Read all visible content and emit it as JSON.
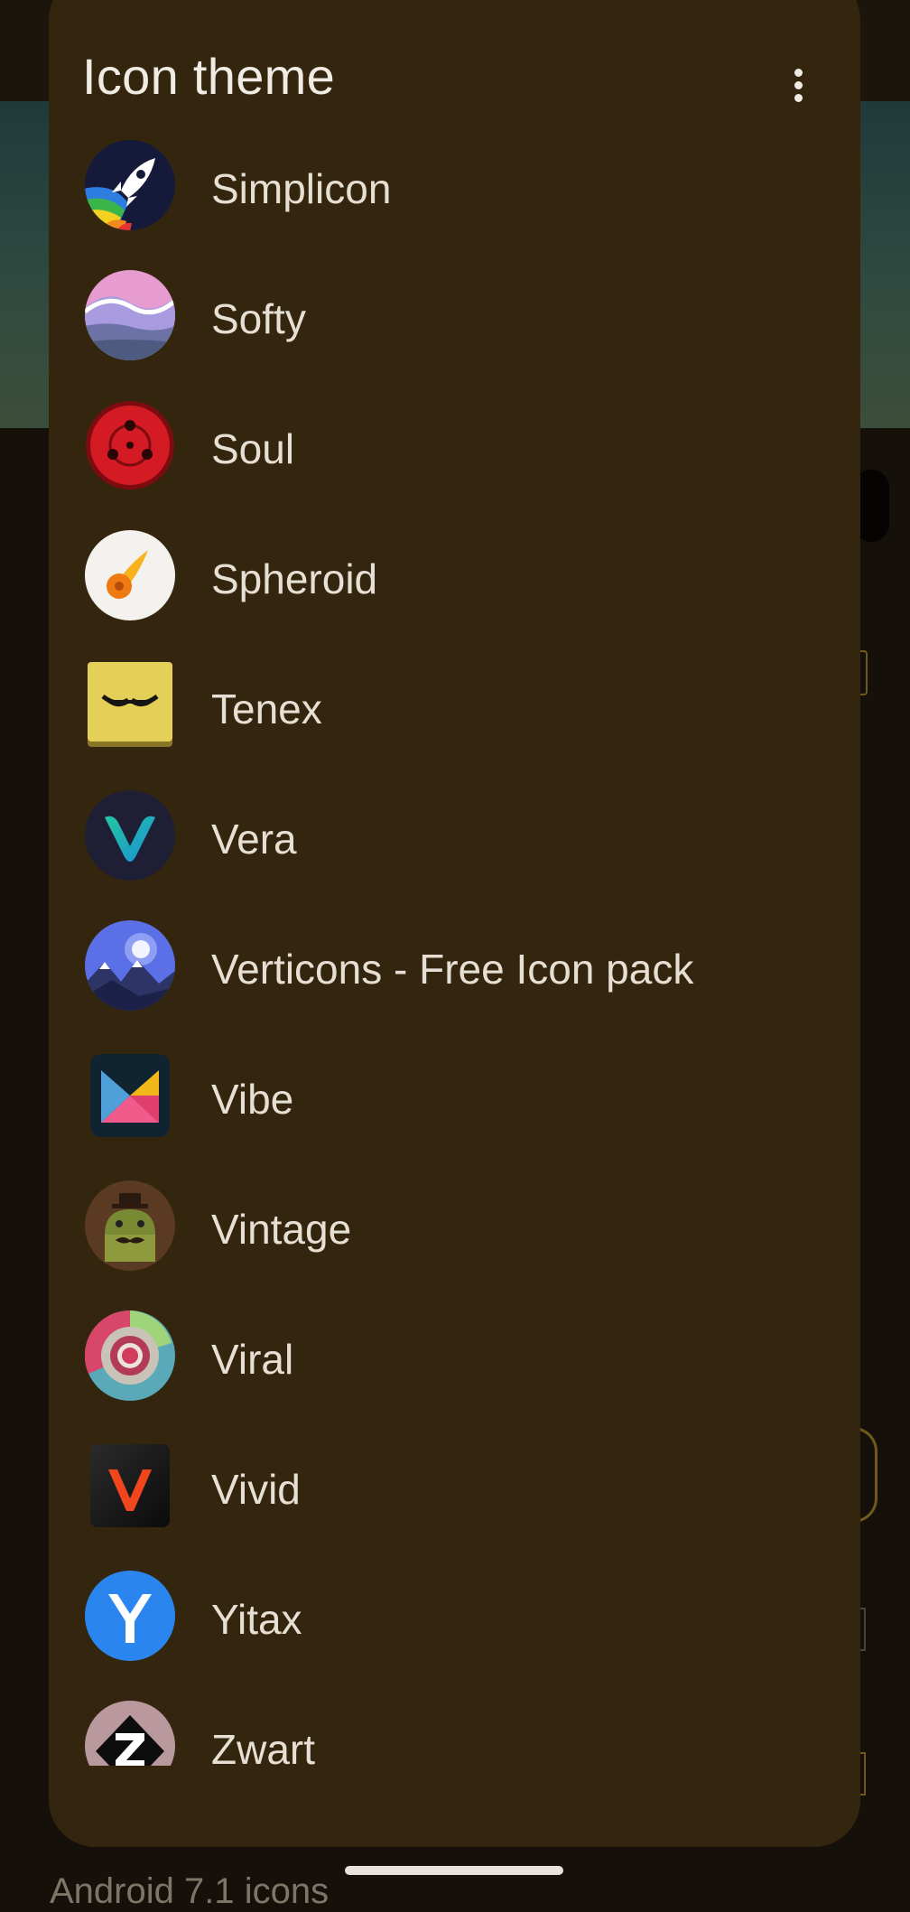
{
  "sheet": {
    "title": "Icon theme",
    "more_icon": "more-vert-icon",
    "items": [
      {
        "label": "Simplicon",
        "icon": "simplicon-rocket-icon"
      },
      {
        "label": "Softy",
        "icon": "softy-waves-icon"
      },
      {
        "label": "Soul",
        "icon": "soul-red-orb-icon"
      },
      {
        "label": "Spheroid",
        "icon": "spheroid-comet-icon"
      },
      {
        "label": "Tenex",
        "icon": "tenex-yellow-square-icon"
      },
      {
        "label": "Vera",
        "icon": "vera-v-logo-icon"
      },
      {
        "label": "Verticons - Free Icon pack",
        "icon": "verticons-moon-mountains-icon"
      },
      {
        "label": "Vibe",
        "icon": "vibe-triangles-icon"
      },
      {
        "label": "Vintage",
        "icon": "vintage-android-icon"
      },
      {
        "label": "Viral",
        "icon": "viral-rings-icon"
      },
      {
        "label": "Vivid",
        "icon": "vivid-v-logo-icon"
      },
      {
        "label": "Yitax",
        "icon": "yitax-y-logo-icon"
      },
      {
        "label": "Zwart",
        "icon": "zwart-z-logo-icon"
      }
    ]
  },
  "background": {
    "partial_text": "Android 7.1 icons"
  },
  "colors": {
    "sheet_bg": "#34260e",
    "title_text": "#f1ece3",
    "item_text": "#e6dfd4",
    "page_bg": "#15100a"
  }
}
